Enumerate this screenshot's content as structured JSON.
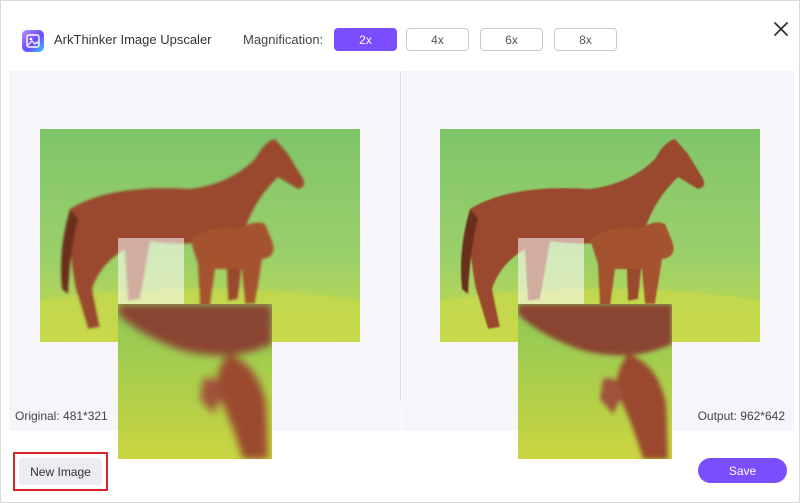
{
  "app": {
    "title": "ArkThinker Image Upscaler",
    "logo_icon": "image-upscaler-logo-icon"
  },
  "magnification": {
    "label": "Magnification:",
    "options": [
      {
        "label": "2x",
        "selected": true
      },
      {
        "label": "4x",
        "selected": false
      },
      {
        "label": "6x",
        "selected": false
      },
      {
        "label": "8x",
        "selected": false
      }
    ]
  },
  "window": {
    "close_icon": "close-icon"
  },
  "original": {
    "label": "Original: 481*321"
  },
  "output": {
    "label": "Output: 962*642"
  },
  "footer": {
    "new_image_label": "New Image",
    "save_label": "Save"
  },
  "colors": {
    "accent": "#7a4dff",
    "highlight_border": "#d9262c",
    "panel_bg": "#f6f6fa"
  }
}
